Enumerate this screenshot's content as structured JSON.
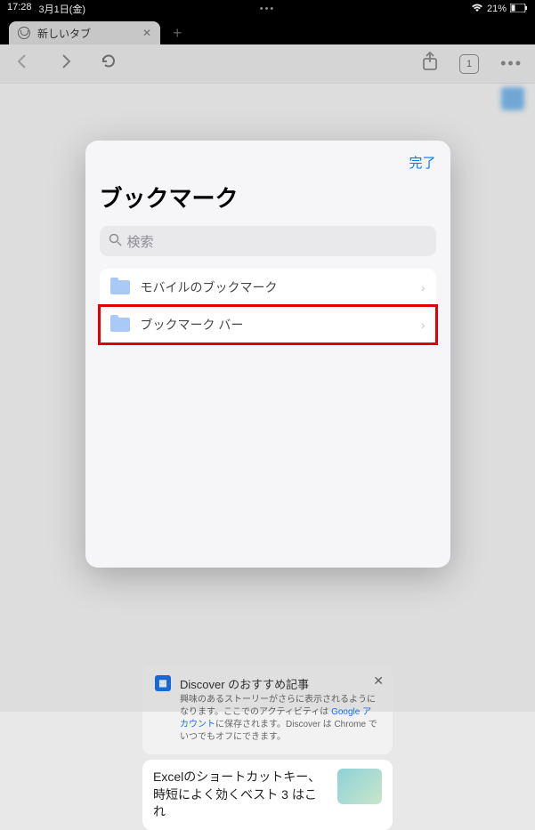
{
  "status": {
    "time": "17:28",
    "date": "3月1日(金)",
    "battery": "21%"
  },
  "tab": {
    "title": "新しいタブ",
    "count": "1"
  },
  "modal": {
    "done": "完了",
    "title": "ブックマーク",
    "search_placeholder": "検索",
    "rows": [
      {
        "label": "モバイルのブックマーク"
      },
      {
        "label": "ブックマーク バー"
      }
    ]
  },
  "discover": {
    "title": "Discover のおすすめ記事",
    "body_pre": "興味のあるストーリーがさらに表示されるようになります。ここでのアクティビティは ",
    "link": "Google アカウント",
    "body_post": "に保存されます。Discover は Chrome でいつでもオフにできます。"
  },
  "article": {
    "title": "Excelのショートカットキー、時短によく効くベスト 3 はこれ"
  }
}
